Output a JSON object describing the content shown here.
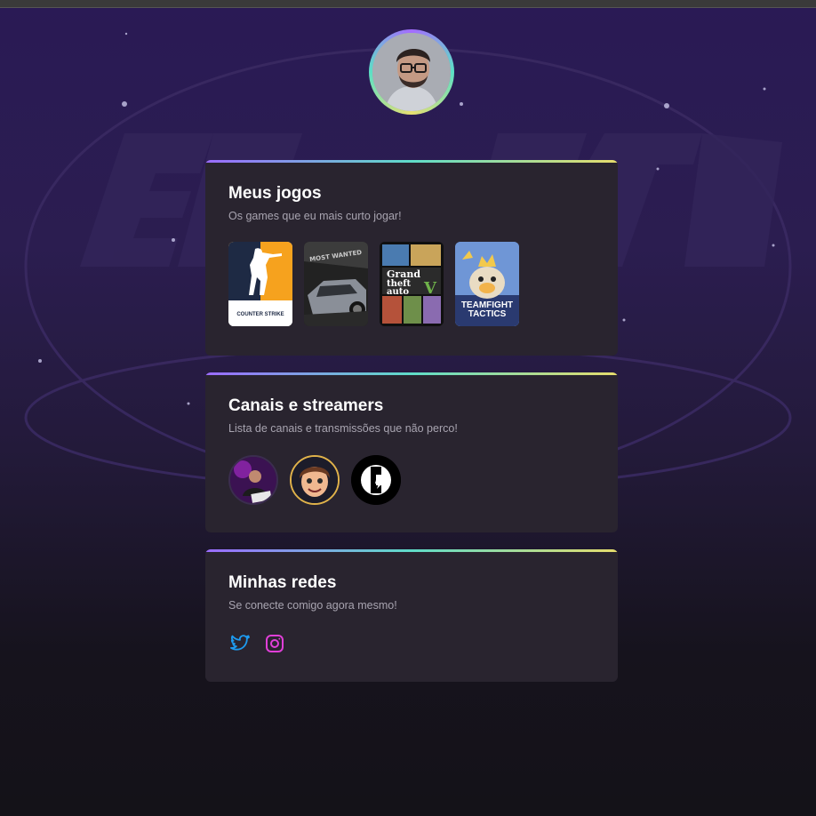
{
  "profile": {
    "avatar_alt": "profile-photo"
  },
  "games_card": {
    "title": "Meus jogos",
    "subtitle": "Os games que eu mais curto jogar!",
    "games": [
      {
        "name": "counter-strike",
        "label": "COUNTER STRIKE"
      },
      {
        "name": "need-for-speed-most-wanted",
        "label": ""
      },
      {
        "name": "grand-theft-auto-v",
        "label": "Grand theft auto"
      },
      {
        "name": "teamfight-tactics",
        "label": "TEAMFIGHT TACTICS"
      }
    ]
  },
  "channels_card": {
    "title": "Canais e streamers",
    "subtitle": "Lista de canais e transmissões que não perco!",
    "channels": [
      "streamer-1",
      "streamer-2",
      "streamer-3"
    ]
  },
  "social_card": {
    "title": "Minhas redes",
    "subtitle": "Se conecte comigo agora mesmo!",
    "links": [
      {
        "name": "twitter",
        "icon": "twitter-icon",
        "color": "#1d9bf0"
      },
      {
        "name": "instagram",
        "icon": "instagram-icon",
        "color": "#e03fd8"
      }
    ]
  },
  "colors": {
    "card_bg": "#29242f",
    "accent_gradient": [
      "#9b6bff",
      "#5fdcc8",
      "#e6dd6c"
    ],
    "subtitle_text": "#a8a4b0"
  }
}
